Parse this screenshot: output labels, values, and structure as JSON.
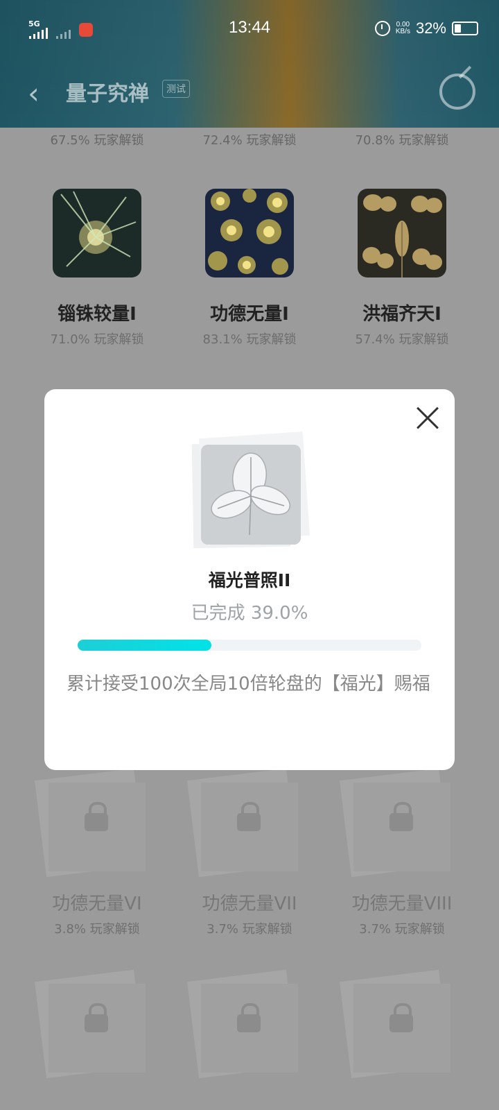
{
  "status_bar": {
    "network": "5G",
    "time": "13:44",
    "speed_value": "0.00",
    "speed_unit": "KB/s",
    "battery_pct": "32%"
  },
  "app_bar": {
    "title": "量子究禅",
    "badge": "测试"
  },
  "top_row_percents": [
    "67.5% 玩家解锁",
    "72.4% 玩家解锁",
    "70.8% 玩家解锁"
  ],
  "achievements": [
    {
      "name": "锱铢较量I",
      "unlock": "71.0% 玩家解锁"
    },
    {
      "name": "功德无量I",
      "unlock": "83.1% 玩家解锁"
    },
    {
      "name": "洪福齐天I",
      "unlock": "57.4% 玩家解锁"
    }
  ],
  "locked_achievements": [
    {
      "name": "功德无量VI",
      "unlock": "3.8% 玩家解锁"
    },
    {
      "name": "功德无量VII",
      "unlock": "3.7% 玩家解锁"
    },
    {
      "name": "功德无量VIII",
      "unlock": "3.7% 玩家解锁"
    }
  ],
  "modal": {
    "title": "福光普照II",
    "progress_text": "已完成 39.0%",
    "progress": 0.39,
    "description": "累计接受100次全局10倍轮盘的【福光】赐福"
  },
  "colors": {
    "progress_start": "#1ccfd6",
    "progress_end": "#00e3e6"
  }
}
